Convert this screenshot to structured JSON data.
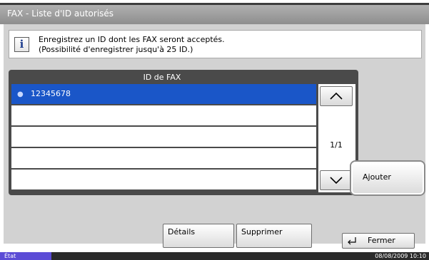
{
  "window": {
    "title": "FAX - Liste d'ID autorisés"
  },
  "info": {
    "line1": "Enregistrez un ID dont les FAX seront acceptés.",
    "line2": "(Possibilité d'enregistrer jusqu'à 25 ID.)",
    "icon": "info-icon"
  },
  "list": {
    "header": "ID de FAX",
    "rows": [
      {
        "text": "12345678",
        "selected": true,
        "icon": "fax-icon"
      },
      {
        "text": ""
      },
      {
        "text": ""
      },
      {
        "text": ""
      },
      {
        "text": ""
      }
    ],
    "page_indicator": "1/1"
  },
  "buttons": {
    "add": "Ajouter",
    "details": "Détails",
    "delete": "Supprimer",
    "close": "Fermer"
  },
  "status": {
    "tab": "État",
    "datetime": "08/08/2009   10:10"
  },
  "colors": {
    "selection": "#1a56c8",
    "panel": "#d2d2d2",
    "status_tab": "#5b4cd6"
  }
}
